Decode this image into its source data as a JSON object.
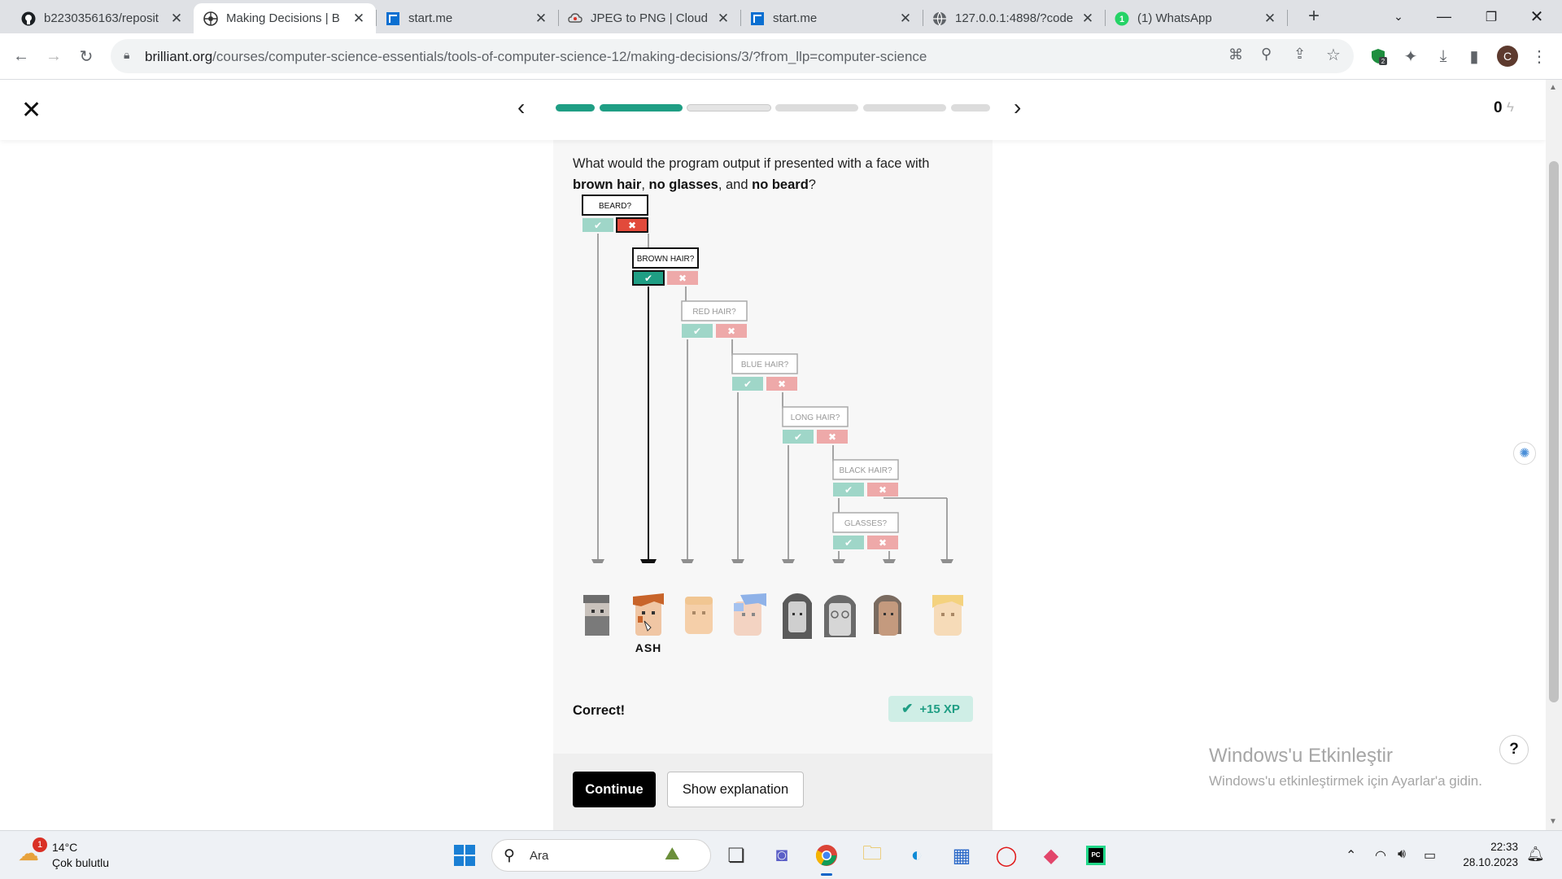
{
  "browser": {
    "tabs": [
      {
        "title": "b2230356163/reposit",
        "icon": "github-icon",
        "active": false
      },
      {
        "title": "Making Decisions | B",
        "icon": "brilliant-icon",
        "active": true
      },
      {
        "title": "start.me",
        "icon": "startme-icon",
        "active": false
      },
      {
        "title": "JPEG to PNG | Cloud",
        "icon": "cloudconvert-icon",
        "active": false
      },
      {
        "title": "start.me",
        "icon": "startme-icon",
        "active": false
      },
      {
        "title": "127.0.0.1:4898/?code",
        "icon": "globe-icon",
        "active": false
      },
      {
        "title": "(1) WhatsApp",
        "icon": "whatsapp-icon",
        "active": false
      }
    ],
    "url_host": "brilliant.org",
    "url_path": "/courses/computer-science-essentials/tools-of-computer-science-12/making-decisions/3/?from_llp=computer-science",
    "profile_initial": "C",
    "extension_badge": "2"
  },
  "lesson": {
    "progress_segments": [
      "done",
      "done",
      "current",
      "todo",
      "todo",
      "todo"
    ],
    "xp_total": "0",
    "question_prefix": "What would the program output if presented with a face with",
    "question_bold1": "brown hair",
    "question_sep1": ", ",
    "question_bold2": "no glasses",
    "question_sep2": ", and ",
    "question_bold3": "no beard",
    "question_suffix": "?",
    "tree_nodes": [
      {
        "label": "BEARD?",
        "state": "active"
      },
      {
        "label": "BROWN HAIR?",
        "state": "active"
      },
      {
        "label": "RED HAIR?",
        "state": "faded"
      },
      {
        "label": "BLUE HAIR?",
        "state": "faded"
      },
      {
        "label": "LONG HAIR?",
        "state": "faded"
      },
      {
        "label": "BLACK HAIR?",
        "state": "faded"
      },
      {
        "label": "GLASSES?",
        "state": "faded"
      }
    ],
    "answer_face_name": "ASH",
    "result_text": "Correct!",
    "xp_reward": "+15 XP",
    "continue_label": "Continue",
    "explain_label": "Show explanation"
  },
  "colors": {
    "accent_green": "#1f9e84",
    "yes_light": "#9fd6c8",
    "no_light": "#eea9a9",
    "no_active": "#e24a3b",
    "yes_active": "#1f9e84"
  },
  "windows": {
    "watermark_title": "Windows'u Etkinleştir",
    "watermark_sub": "Windows'u etkinleştirmek için Ayarlar'a gidin.",
    "help_label": "?"
  },
  "taskbar": {
    "temperature": "14°C",
    "condition": "Çok bulutlu",
    "weather_badge": "1",
    "search_placeholder": "Ara",
    "time": "22:33",
    "date": "28.10.2023"
  }
}
